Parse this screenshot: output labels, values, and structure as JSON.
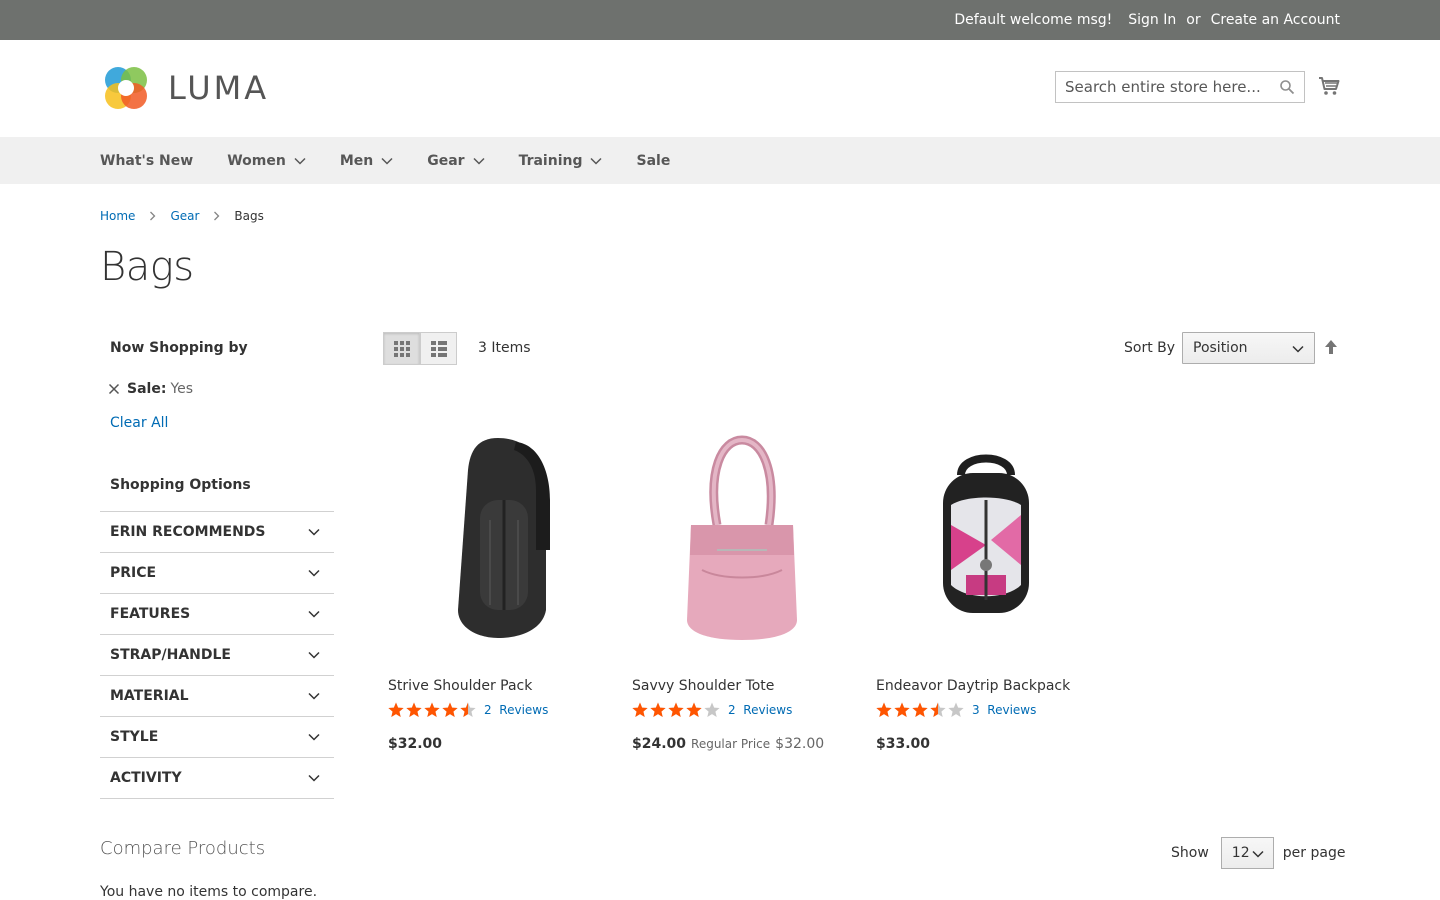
{
  "topbar": {
    "welcome": "Default welcome msg!",
    "sign_in": "Sign In",
    "or": "or",
    "create_account": "Create an Account"
  },
  "header": {
    "logo_text": "LUMA",
    "search_placeholder": "Search entire store here...",
    "search_icon": "search-icon",
    "cart_icon": "cart-icon"
  },
  "nav": {
    "items": [
      {
        "label": "What's New",
        "has_dropdown": false
      },
      {
        "label": "Women",
        "has_dropdown": true
      },
      {
        "label": "Men",
        "has_dropdown": true
      },
      {
        "label": "Gear",
        "has_dropdown": true
      },
      {
        "label": "Training",
        "has_dropdown": true
      },
      {
        "label": "Sale",
        "has_dropdown": false
      }
    ]
  },
  "breadcrumb": {
    "items": [
      "Home",
      "Gear",
      "Bags"
    ]
  },
  "page": {
    "title": "Bags"
  },
  "sidebar": {
    "now_shopping_by": "Now Shopping by",
    "active_filter": {
      "label": "Sale:",
      "value": "Yes"
    },
    "clear_all": "Clear All",
    "shopping_options": "Shopping Options",
    "options": [
      "ERIN RECOMMENDS",
      "PRICE",
      "FEATURES",
      "STRAP/HANDLE",
      "MATERIAL",
      "STYLE",
      "ACTIVITY"
    ]
  },
  "toolbar": {
    "items_count": "3 Items",
    "sort_by_label": "Sort By",
    "sort_selected": "Position",
    "view_mode": "grid"
  },
  "products": [
    {
      "name": "Strive Shoulder Pack",
      "rating": 4.5,
      "reviews_count": "2",
      "reviews_label": "Reviews",
      "price": "$32.00",
      "regular_price_label": "",
      "regular_price": ""
    },
    {
      "name": "Savvy Shoulder Tote",
      "rating": 4,
      "reviews_count": "2",
      "reviews_label": "Reviews",
      "price": "$24.00",
      "regular_price_label": "Regular Price",
      "regular_price": "$32.00"
    },
    {
      "name": "Endeavor Daytrip Backpack",
      "rating": 3.5,
      "reviews_count": "3",
      "reviews_label": "Reviews",
      "price": "$33.00",
      "regular_price_label": "",
      "regular_price": ""
    }
  ],
  "compare": {
    "title": "Compare Products",
    "empty": "You have no items to compare."
  },
  "limiter": {
    "show": "Show",
    "selected": "12",
    "per_page": "per page"
  },
  "colors": {
    "topbar": "#6e716e",
    "link": "#006bb4",
    "star": "#ff5501",
    "star_empty": "#c7c7c7"
  }
}
